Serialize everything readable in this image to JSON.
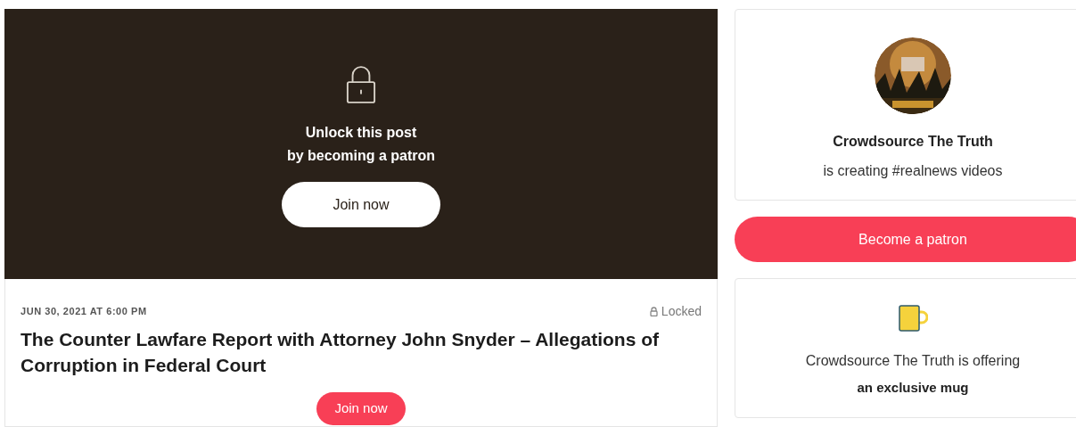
{
  "locked_overlay": {
    "message_lines": [
      "Unlock this post",
      "by becoming a patron"
    ],
    "button": "Join now"
  },
  "post": {
    "date": "JUN 30, 2021 AT 6:00 PM",
    "status": "Locked",
    "title": "The Counter Lawfare Report with Attorney John Snyder – Allegations of Corruption in Federal Court",
    "button": "Join now"
  },
  "creator": {
    "name": "Crowdsource The Truth",
    "tagline": "is creating #realnews videos"
  },
  "become_button": "Become a patron",
  "offer": {
    "text": "Crowdsource The Truth is offering",
    "bold": "an exclusive mug"
  }
}
